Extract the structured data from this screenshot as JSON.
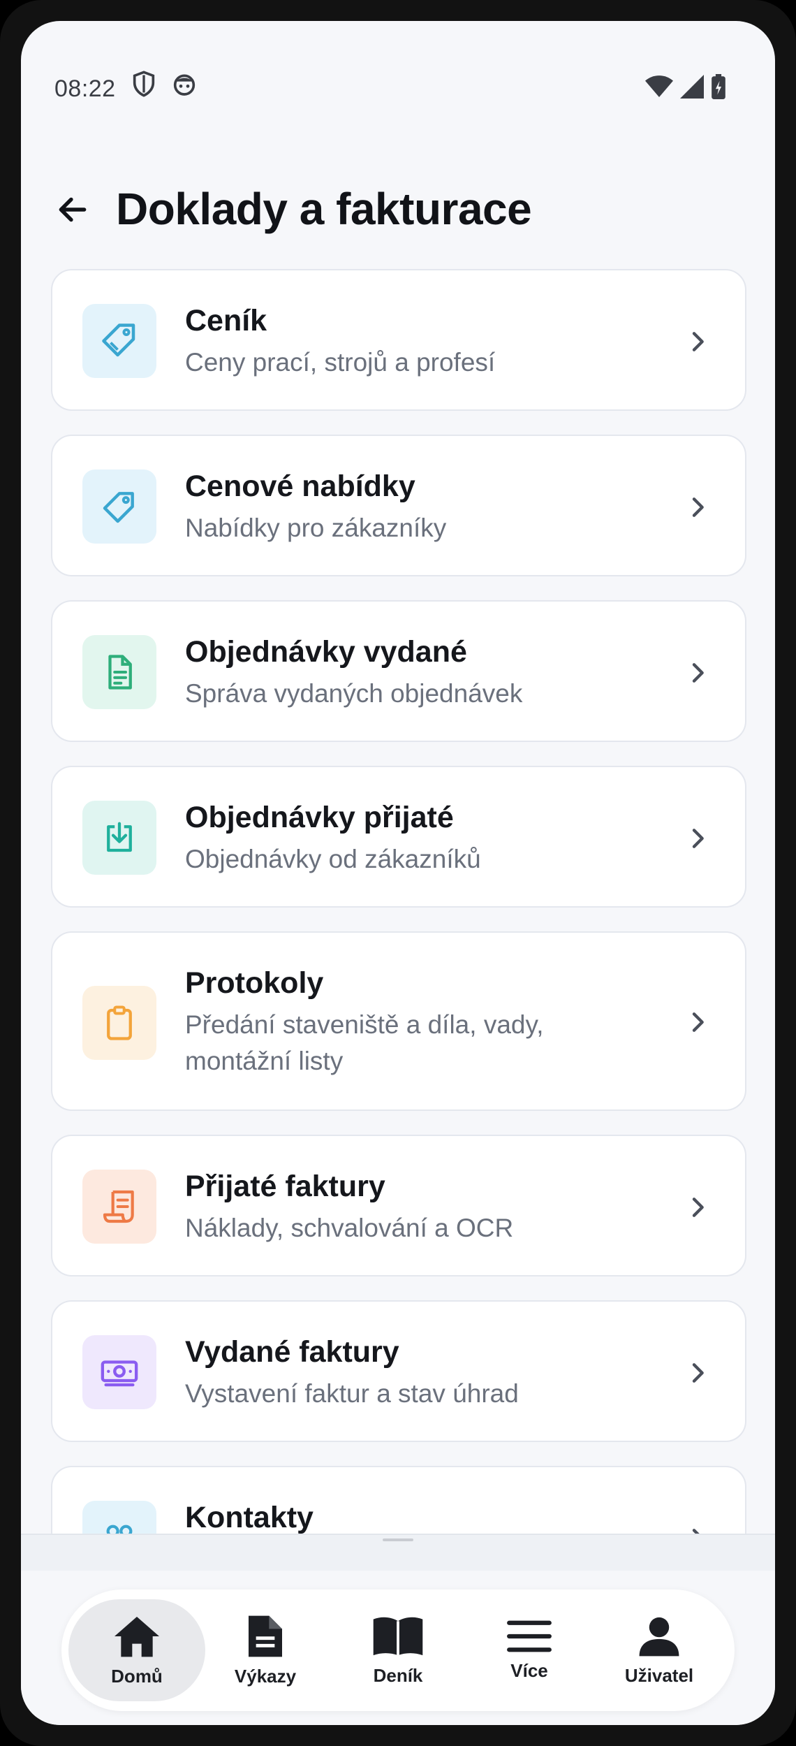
{
  "status": {
    "time": "08:22"
  },
  "header": {
    "title": "Doklady a fakturace"
  },
  "items": [
    {
      "title": "Ceník",
      "subtitle": "Ceny prací, strojů a profesí",
      "icon": "tag-icon",
      "icon_color": "#3aa6d0",
      "icon_bg": "#e3f3fb"
    },
    {
      "title": "Cenové nabídky",
      "subtitle": "Nabídky pro zákazníky",
      "icon": "tag-icon",
      "icon_color": "#3aa6d0",
      "icon_bg": "#e3f3fb"
    },
    {
      "title": "Objednávky vydané",
      "subtitle": "Správa vydaných objednávek",
      "icon": "document-icon",
      "icon_color": "#2eae7a",
      "icon_bg": "#e2f6ee"
    },
    {
      "title": "Objednávky přijaté",
      "subtitle": "Objednávky od zákazníků",
      "icon": "download-icon",
      "icon_color": "#1fb09c",
      "icon_bg": "#e0f5f1"
    },
    {
      "title": "Protokoly",
      "subtitle": "Předání staveniště a díla, vady, montážní listy",
      "icon": "clipboard-icon",
      "icon_color": "#f3a43a",
      "icon_bg": "#fdf1e0"
    },
    {
      "title": "Přijaté faktury",
      "subtitle": "Náklady, schvalování a OCR",
      "icon": "receipt-icon",
      "icon_color": "#ee7a46",
      "icon_bg": "#fde9df"
    },
    {
      "title": "Vydané faktury",
      "subtitle": "Vystavení faktur a stav úhrad",
      "icon": "banknote-icon",
      "icon_color": "#8a5cf0",
      "icon_bg": "#efe8fd"
    },
    {
      "title": "Kontakty",
      "subtitle": "",
      "icon": "contacts-icon",
      "icon_color": "#3aa6d0",
      "icon_bg": "#e3f3fb"
    }
  ],
  "nav": [
    {
      "label": "Domů",
      "icon": "home-icon",
      "active": true
    },
    {
      "label": "Výkazy",
      "icon": "report-icon",
      "active": false
    },
    {
      "label": "Deník",
      "icon": "book-icon",
      "active": false
    },
    {
      "label": "Více",
      "icon": "menu-icon",
      "active": false
    },
    {
      "label": "Uživatel",
      "icon": "user-icon",
      "active": false
    }
  ]
}
